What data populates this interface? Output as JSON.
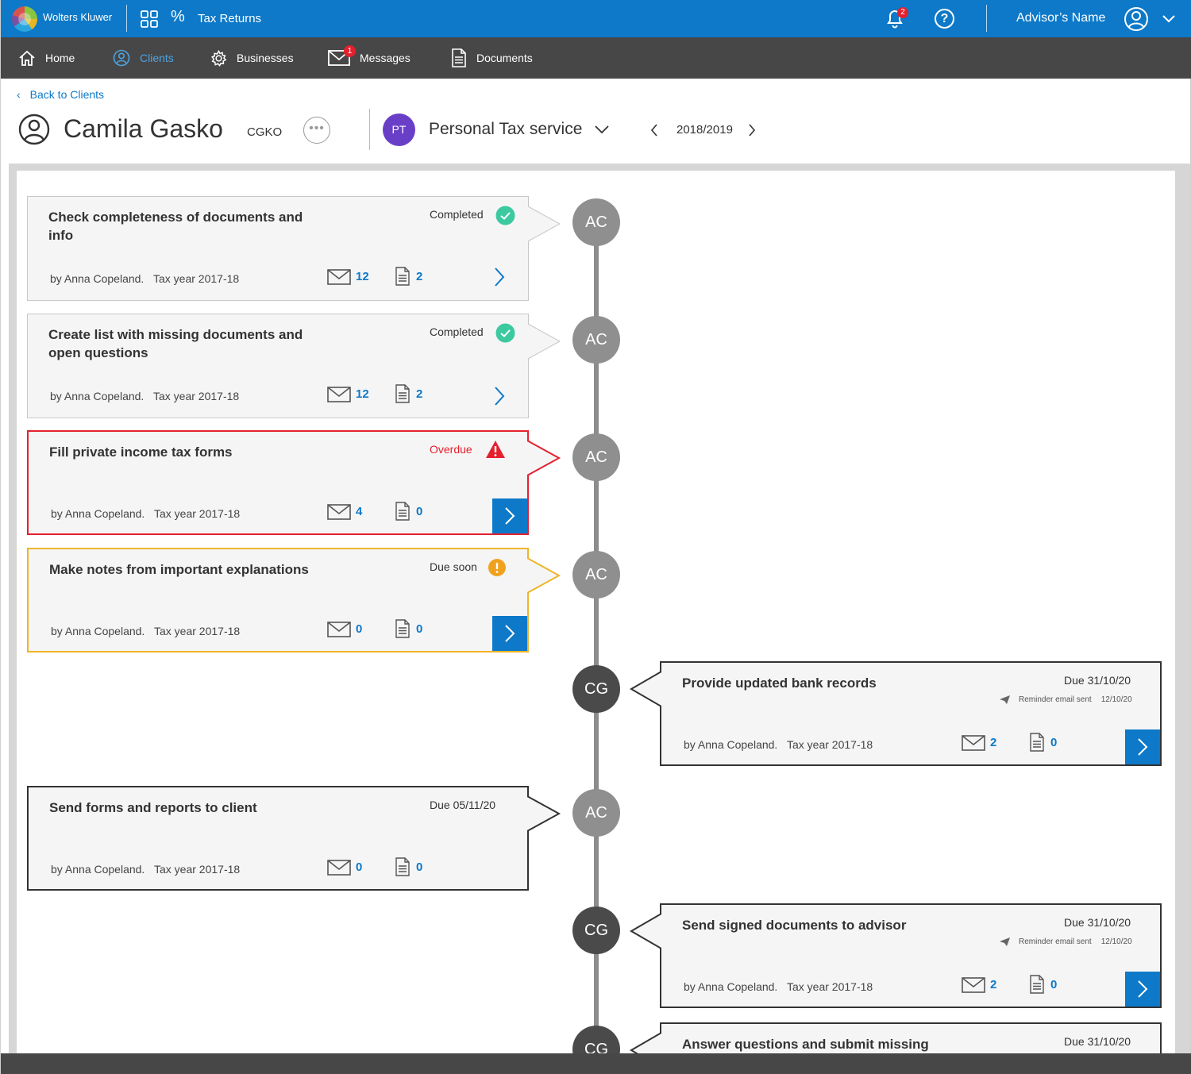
{
  "topbar": {
    "brand": "Wolters Kluwer",
    "app_title": "Tax Returns",
    "notifications_count": "2",
    "help_label": "?",
    "advisor_name": "Advisor’s Name"
  },
  "nav": {
    "items": [
      {
        "label": "Home",
        "icon": "home-icon"
      },
      {
        "label": "Clients",
        "icon": "user-circle-icon",
        "active": true
      },
      {
        "label": "Businesses",
        "icon": "gear-icon"
      },
      {
        "label": "Messages",
        "icon": "mail-icon",
        "badge": "1"
      },
      {
        "label": "Documents",
        "icon": "document-icon"
      }
    ]
  },
  "header": {
    "back_label": "Back to Clients",
    "client_name": "Camila Gasko",
    "client_code": "CGKO",
    "more_label": "•••",
    "service_badge": "PT",
    "service_name": "Personal Tax service",
    "year": "2018/2019"
  },
  "colors": {
    "primary": "#0d79c8",
    "overdue": "#e5202e",
    "due_soon": "#f0b429",
    "completed": "#3dc9a0",
    "node_advisor": "#8f8f8f",
    "node_client": "#4a4a4a"
  },
  "tasks": [
    {
      "title": "Check completeness of documents and info",
      "status": "Completed",
      "state": "completed",
      "assignee": "AC",
      "by": "by Anna Copeland.",
      "tax_year": "Tax year 2017-18",
      "mail_count": "12",
      "doc_count": "2"
    },
    {
      "title": "Create list with missing documents and open questions",
      "status": "Completed",
      "state": "completed",
      "assignee": "AC",
      "by": "by Anna Copeland.",
      "tax_year": "Tax year 2017-18",
      "mail_count": "12",
      "doc_count": "2"
    },
    {
      "title": "Fill private income tax forms",
      "status": "Overdue",
      "state": "overdue",
      "assignee": "AC",
      "by": "by Anna Copeland.",
      "tax_year": "Tax year 2017-18",
      "mail_count": "4",
      "doc_count": "0"
    },
    {
      "title": "Make notes from important explanations",
      "status": "Due soon",
      "state": "due-soon",
      "assignee": "AC",
      "by": "by Anna Copeland.",
      "tax_year": "Tax year 2017-18",
      "mail_count": "0",
      "doc_count": "0"
    },
    {
      "title": "Provide updated bank records",
      "status": "Due 31/10/20",
      "state": "client",
      "assignee": "CG",
      "by": "by Anna Copeland.",
      "tax_year": "Tax year 2017-18",
      "mail_count": "2",
      "doc_count": "0",
      "reminder": "Reminder email sent",
      "reminder_date": "12/10/20"
    },
    {
      "title": "Send forms and reports to client",
      "status": "Due 05/11/20",
      "state": "todo",
      "assignee": "AC",
      "by": "by Anna Copeland.",
      "tax_year": "Tax year 2017-18",
      "mail_count": "0",
      "doc_count": "0"
    },
    {
      "title": "Send signed documents to advisor",
      "status": "Due 31/10/20",
      "state": "client",
      "assignee": "CG",
      "by": "by Anna Copeland.",
      "tax_year": "Tax year 2017-18",
      "mail_count": "2",
      "doc_count": "0",
      "reminder": "Reminder email sent",
      "reminder_date": "12/10/20"
    },
    {
      "title": "Answer questions and submit missing",
      "status": "Due 31/10/20",
      "state": "client",
      "assignee": "CG"
    }
  ]
}
